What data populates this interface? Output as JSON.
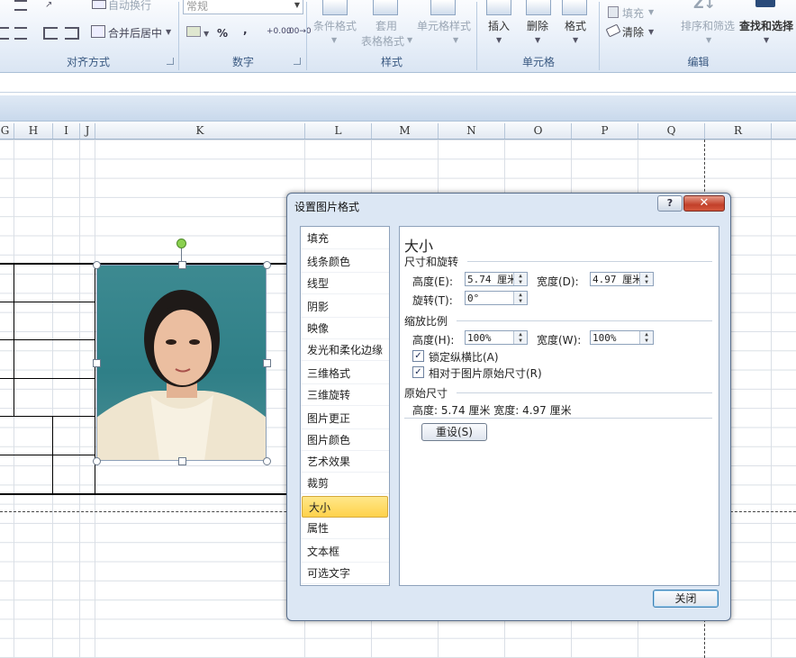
{
  "ribbon": {
    "wrap_text": "自动换行",
    "merge_center": "合并后居中",
    "number_format": "常规",
    "percent": "%",
    "comma": ",",
    "cond_format": "条件格式",
    "table_format_1": "套用",
    "table_format_2": "表格格式",
    "cell_styles": "单元格样式",
    "insert": "插入",
    "delete": "删除",
    "format": "格式",
    "fill": "填充",
    "clear": "清除",
    "sort_filter": "排序和筛选",
    "find_select": "查找和选择",
    "groups": {
      "alignment": "对齐方式",
      "number": "数字",
      "styles": "样式",
      "cells": "单元格",
      "editing": "编辑"
    }
  },
  "columns": [
    "G",
    "H",
    "I",
    "J",
    "K",
    "L",
    "M",
    "N",
    "O",
    "P",
    "Q",
    "R"
  ],
  "dialog": {
    "title": "设置图片格式",
    "help": "?",
    "close_x": "✕",
    "nav": [
      "填充",
      "线条颜色",
      "线型",
      "阴影",
      "映像",
      "发光和柔化边缘",
      "三维格式",
      "三维旋转",
      "图片更正",
      "图片颜色",
      "艺术效果",
      "裁剪",
      "大小",
      "属性",
      "文本框",
      "可选文字"
    ],
    "selected_nav": "大小",
    "panel": {
      "heading": "大小",
      "size_rotate": "尺寸和旋转",
      "height_label": "高度(E):",
      "height_value": "5.74 厘米",
      "width_label": "宽度(D):",
      "width_value": "4.97 厘米",
      "rotation_label": "旋转(T):",
      "rotation_value": "0°",
      "scale": "缩放比例",
      "scale_h_label": "高度(H):",
      "scale_h_value": "100%",
      "scale_w_label": "宽度(W):",
      "scale_w_value": "100%",
      "lock_aspect": "锁定纵横比(A)",
      "relative_original": "相对于图片原始尺寸(R)",
      "original_size": "原始尺寸",
      "original_values": "高度:  5.74 厘米   宽度:  4.97 厘米",
      "reset": "重设(S)"
    },
    "close_button": "关闭"
  }
}
